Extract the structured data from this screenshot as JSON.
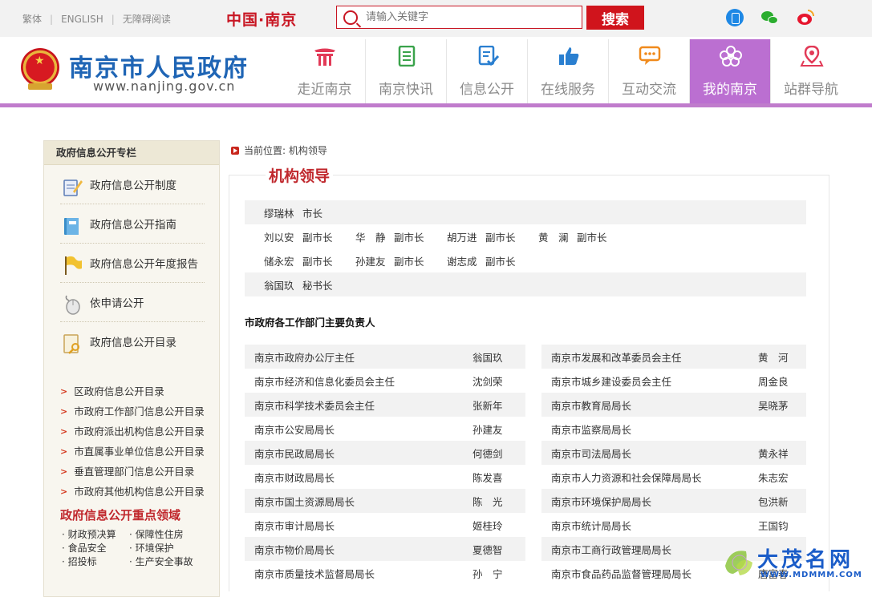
{
  "topbar": {
    "links": [
      "繁体",
      "ENGLISH",
      "无障碍阅读"
    ],
    "brand": "中国·南京",
    "search_placeholder": "请输入关键字",
    "search_button": "搜索"
  },
  "header": {
    "title": "南京市人民政府",
    "url": "www.nanjing.gov.cn",
    "nav": [
      {
        "label": "走近南京",
        "icon": "gate-icon",
        "color": "#e23a57"
      },
      {
        "label": "南京快讯",
        "icon": "newspaper-icon",
        "color": "#3aa34b"
      },
      {
        "label": "信息公开",
        "icon": "document-check-icon",
        "color": "#2a7fd0"
      },
      {
        "label": "在线服务",
        "icon": "thumbs-up-icon",
        "color": "#2a7fd0"
      },
      {
        "label": "互动交流",
        "icon": "chat-bubble-icon",
        "color": "#f08a1c"
      },
      {
        "label": "我的南京",
        "icon": "flower-icon",
        "color": "#ffffff",
        "active": true
      },
      {
        "label": "站群导航",
        "icon": "location-pin-icon",
        "color": "#e23a57"
      }
    ]
  },
  "sidebar": {
    "heading": "政府信息公开专栏",
    "items": [
      {
        "label": "政府信息公开制度",
        "icon": "notepad-pencil-icon"
      },
      {
        "label": "政府信息公开指南",
        "icon": "book-icon"
      },
      {
        "label": "政府信息公开年度报告",
        "icon": "flag-icon"
      },
      {
        "label": "依申请公开",
        "icon": "mouse-icon"
      },
      {
        "label": "政府信息公开目录",
        "icon": "key-document-icon"
      }
    ],
    "links": [
      "区政府信息公开目录",
      "市政府工作部门信息公开目录",
      "市政府派出机构信息公开目录",
      "市直属事业单位信息公开目录",
      "垂直管理部门信息公开目录",
      "市政府其他机构信息公开目录"
    ],
    "focus_heading": "政府信息公开重点领域",
    "focus_items": [
      "· 财政预决算",
      "· 保障性住房",
      "· 食品安全",
      "· 环境保护",
      "· 招投标",
      "· 生产安全事故"
    ]
  },
  "main": {
    "breadcrumb": "当前位置: 机构领导",
    "title": "机构领导",
    "leaders": [
      [
        {
          "name": "缪瑞林",
          "post": "市长"
        }
      ],
      [
        {
          "name": "刘以安",
          "post": "副市长"
        },
        {
          "name": "华　静",
          "post": "副市长"
        },
        {
          "name": "胡万进",
          "post": "副市长"
        },
        {
          "name": "黄　澜",
          "post": "副市长"
        }
      ],
      [
        {
          "name": "储永宏",
          "post": "副市长"
        },
        {
          "name": "孙建友",
          "post": "副市长"
        },
        {
          "name": "谢志成",
          "post": "副市长"
        }
      ],
      [
        {
          "name": "翁国玖",
          "post": "秘书长"
        }
      ]
    ],
    "dept_heading": "市政府各工作部门主要负责人",
    "dept_left": [
      {
        "dept": "南京市政府办公厅主任",
        "person": "翁国玖"
      },
      {
        "dept": "南京市经济和信息化委员会主任",
        "person": "沈剑荣"
      },
      {
        "dept": "南京市科学技术委员会主任",
        "person": "张新年"
      },
      {
        "dept": "南京市公安局局长",
        "person": "孙建友"
      },
      {
        "dept": "南京市民政局局长",
        "person": "何德剑"
      },
      {
        "dept": "南京市财政局局长",
        "person": "陈发喜"
      },
      {
        "dept": "南京市国土资源局局长",
        "person": "陈　光"
      },
      {
        "dept": "南京市审计局局长",
        "person": "姬桂玲"
      },
      {
        "dept": "南京市物价局局长",
        "person": "夏德智"
      },
      {
        "dept": "南京市质量技术监督局局长",
        "person": "孙　宁"
      }
    ],
    "dept_right": [
      {
        "dept": "南京市发展和改革委员会主任",
        "person": "黄　河"
      },
      {
        "dept": "南京市城乡建设委员会主任",
        "person": "周金良"
      },
      {
        "dept": "南京市教育局局长",
        "person": "吴晓茅"
      },
      {
        "dept": "南京市监察局局长",
        "person": ""
      },
      {
        "dept": "南京市司法局局长",
        "person": "黄永祥"
      },
      {
        "dept": "南京市人力资源和社会保障局局长",
        "person": "朱志宏"
      },
      {
        "dept": "南京市环境保护局局长",
        "person": "包洪新"
      },
      {
        "dept": "南京市统计局局长",
        "person": "王国钧"
      },
      {
        "dept": "南京市工商行政管理局局长",
        "person": ""
      },
      {
        "dept": "南京市食品药品监督管理局局长",
        "person": "唐富春"
      }
    ]
  },
  "watermark": {
    "name": "大茂名网",
    "url": "WWW.MDMMM.COM"
  }
}
